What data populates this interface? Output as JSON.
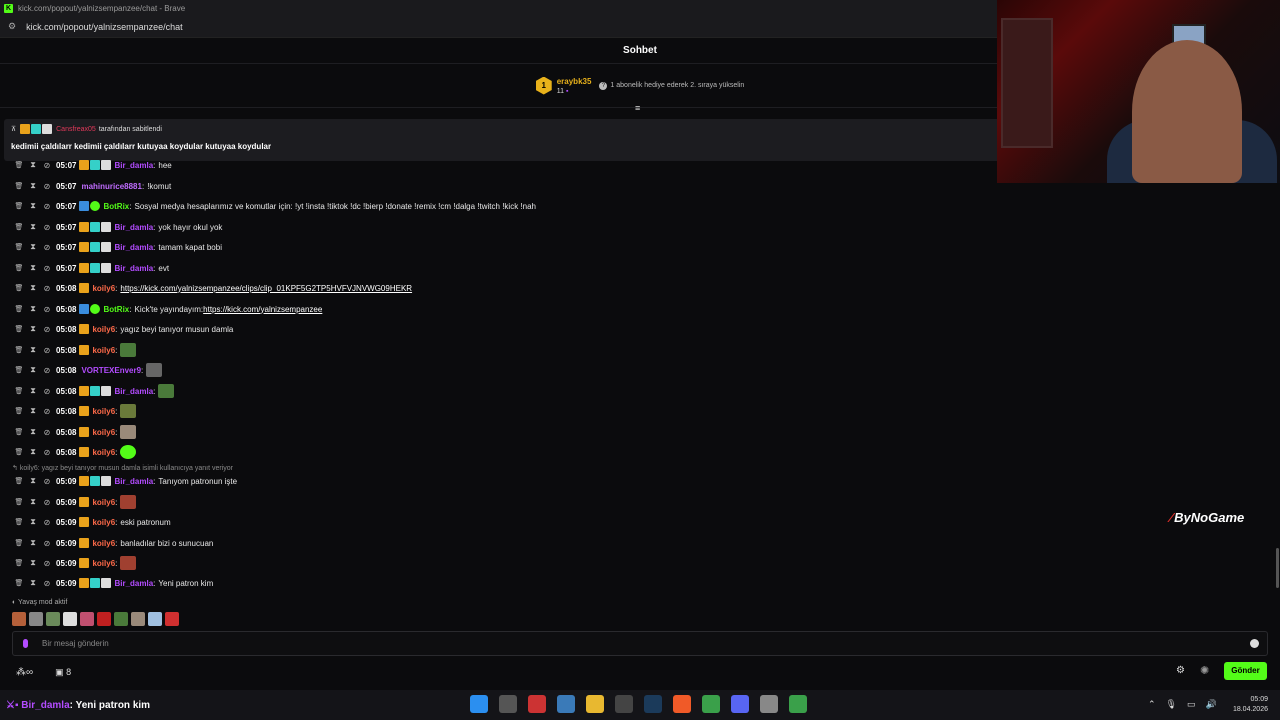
{
  "browser": {
    "title": "kick.com/popout/yalnizsempanzee/chat - Brave",
    "url": "kick.com/popout/yalnizsempanzee/chat"
  },
  "chat_header": {
    "title": "Sohbet"
  },
  "leaderboard": {
    "rank": "1",
    "username": "eraybk35",
    "count": "11",
    "hint": "1 abonelik hediye ederek 2. sıraya yükselin"
  },
  "pinned": {
    "user": "Cansfreax05",
    "suffix": "tarafından sabitlendi",
    "message": "kedimii çaldılarr kedimii çaldılarr kutuyaa koydular kutuyaa koydular"
  },
  "messages": [
    {
      "time": "05:07",
      "user": "Bir_damla",
      "text": "hee"
    },
    {
      "time": "05:07",
      "user": "mahinurice8881",
      "text": "!komut"
    },
    {
      "time": "05:07",
      "user": "BotRix",
      "text": "Sosyal medya hesaplarımız ve komutlar için: !yt !insta !tiktok !dc !bierp !donate !remix !cm !dalga !twitch !kick !nah"
    },
    {
      "time": "05:07",
      "user": "Bir_damla",
      "text": "yok hayır okul yok"
    },
    {
      "time": "05:07",
      "user": "Bir_damla",
      "text": "tamam kapat bobi"
    },
    {
      "time": "05:07",
      "user": "Bir_damla",
      "text": "evt"
    },
    {
      "time": "05:08",
      "user": "koily6",
      "text": "https://kick.com/yalnizsempanzee/clips/clip_01KPF5G2TP5HVFVJNVWG09HEKR"
    },
    {
      "time": "05:08",
      "user": "BotRix",
      "text_prefix": "Kick'te yayındayım: ",
      "link": "https://kick.com/yalnizsempanzee"
    },
    {
      "time": "05:08",
      "user": "koily6",
      "text": "yagız beyi tanıyor musun damla"
    },
    {
      "time": "05:08",
      "user": "koily6",
      "text": ""
    },
    {
      "time": "05:08",
      "user": "VORTEXEnver9",
      "text": ""
    },
    {
      "time": "05:08",
      "user": "Bir_damla",
      "text": ""
    },
    {
      "time": "05:08",
      "user": "koily6",
      "text": ""
    },
    {
      "time": "05:08",
      "user": "koily6",
      "text": ""
    },
    {
      "time": "05:08",
      "user": "koily6",
      "text": ""
    },
    {
      "time": "05:09",
      "user": "Bir_damla",
      "text": "Tanıyom patronun işte"
    },
    {
      "time": "05:09",
      "user": "koily6",
      "text": ""
    },
    {
      "time": "05:09",
      "user": "koily6",
      "text": "eski patronum"
    },
    {
      "time": "05:09",
      "user": "koily6",
      "text": "banladılar bizi o sunucuan"
    },
    {
      "time": "05:09",
      "user": "koily6",
      "text": ""
    },
    {
      "time": "05:09",
      "user": "Bir_damla",
      "text": "Yeni patron kim"
    }
  ],
  "reply_note": "koily6: yagız beyi tanıyor musun damla isimli kullanıcıya yanıt veriyor",
  "slow_mode": "Yavaş mod aktif",
  "input": {
    "placeholder": "Bir mesaj gönderin"
  },
  "bottom": {
    "gift_count": "8",
    "send_label": "Gönder"
  },
  "watermark": "ByNoGame",
  "now_playing": {
    "user": "Bir_damla",
    "message": ": Yeni patron kim"
  },
  "clock": {
    "time": "05:09",
    "date": "18.04.2026"
  },
  "colors": {
    "kick_green": "#53fc18",
    "bir_damla": "#b34cff",
    "koily6": "#ff6b4a",
    "mahinurice8881": "#c06cff",
    "botrix": "#53fc18",
    "vortex": "#b34cff",
    "pinned_user": "#e0395a"
  }
}
